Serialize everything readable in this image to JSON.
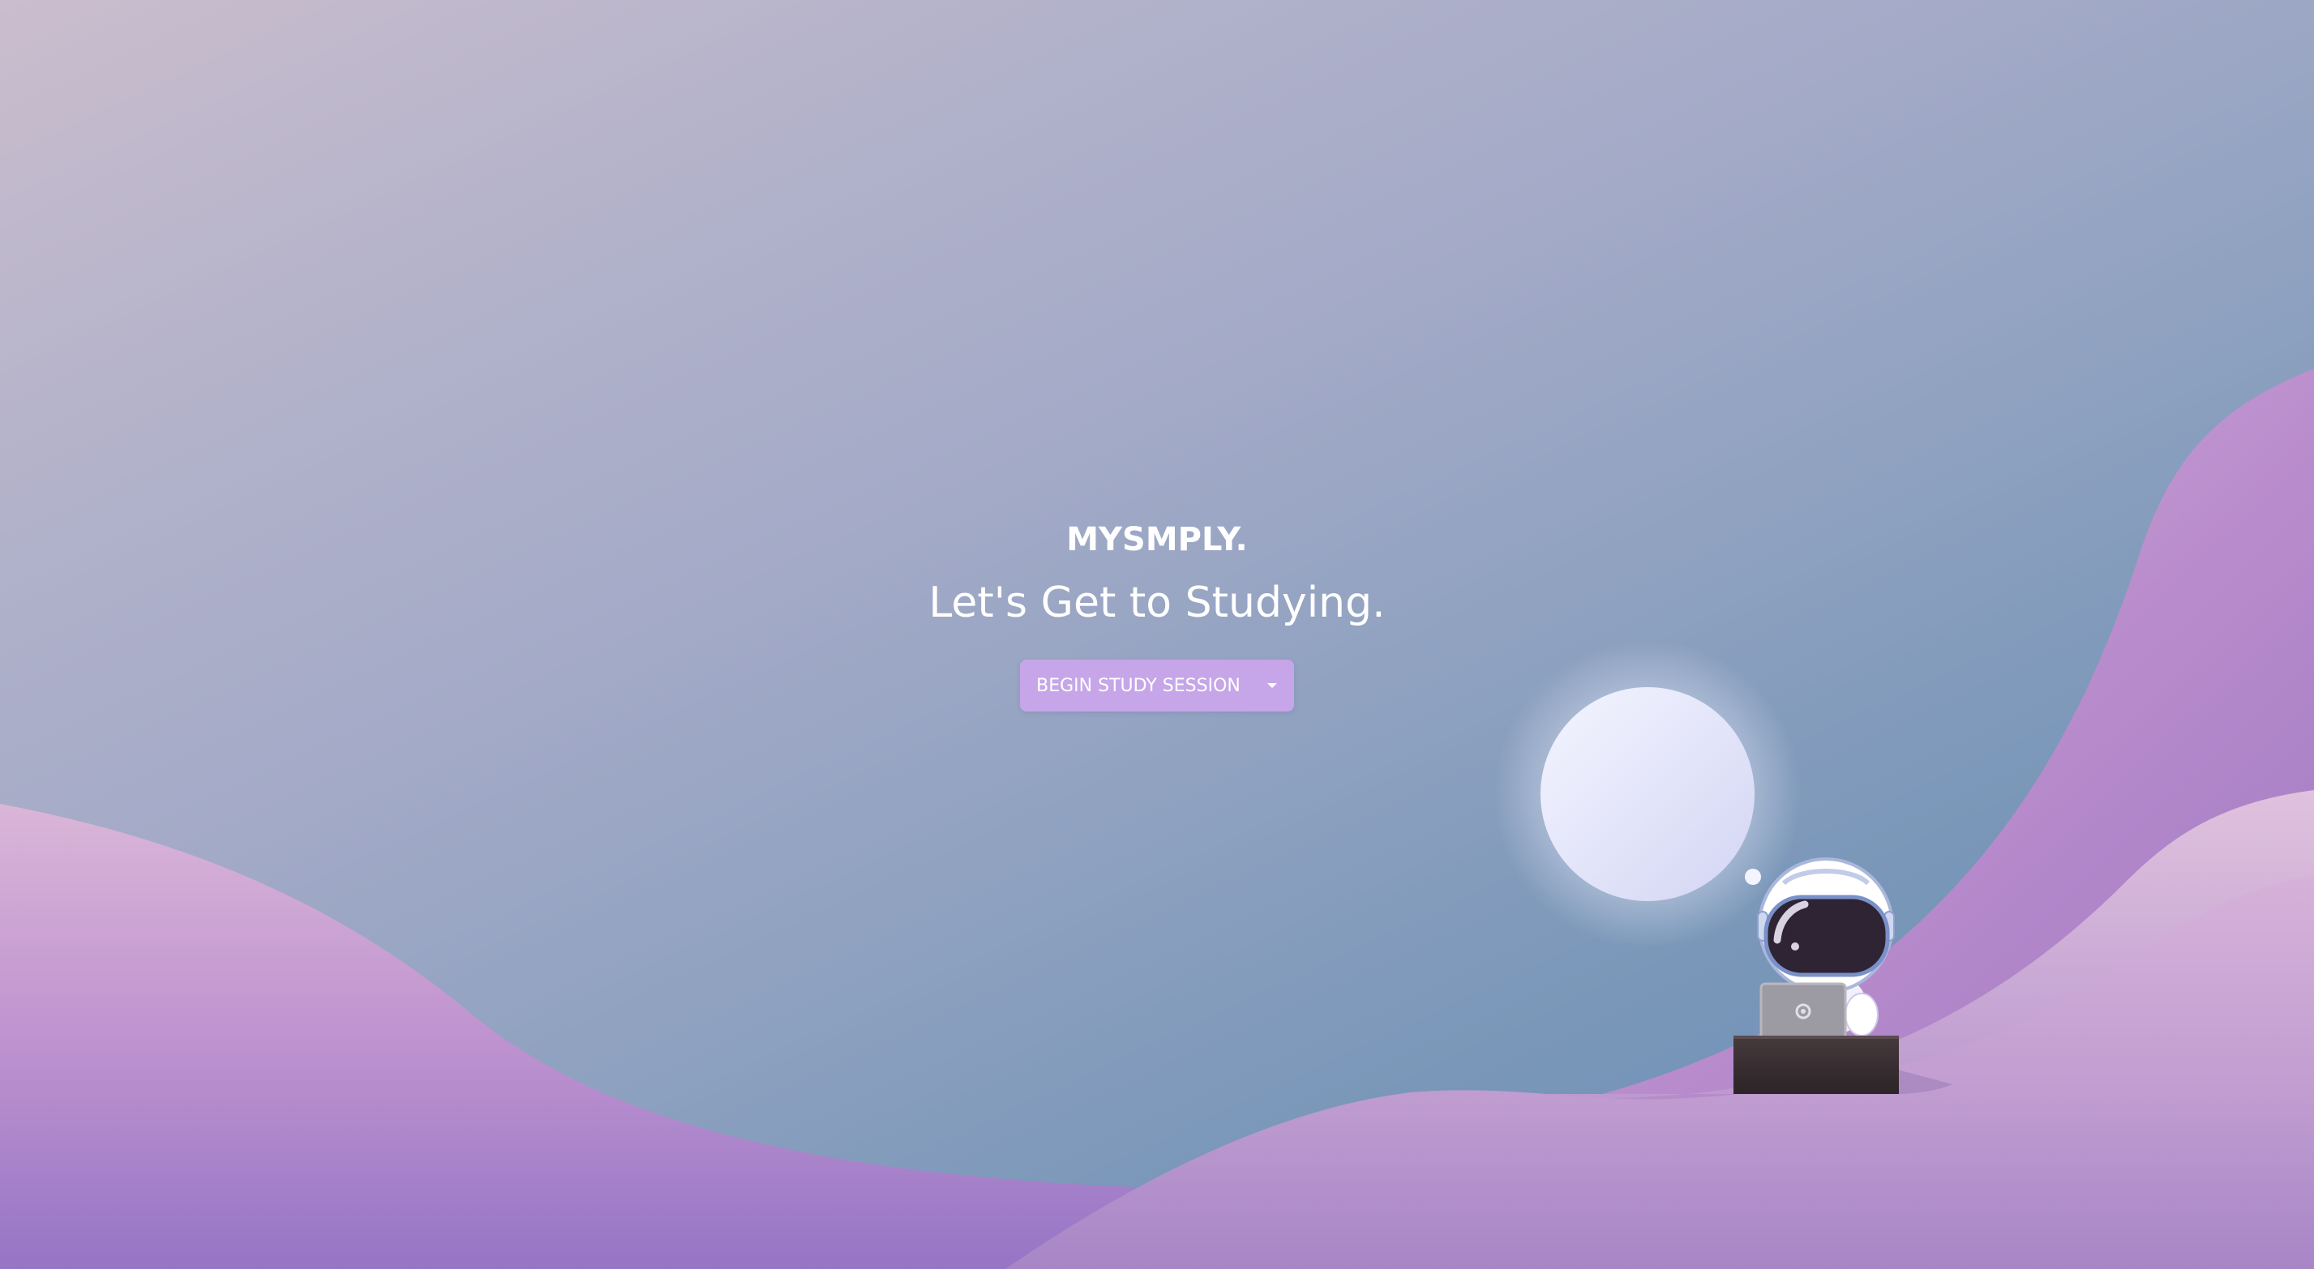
{
  "brand": "MYSMPLY.",
  "tagline": "Let's Get to Studying.",
  "cta": {
    "label": "BEGIN STUDY SESSION",
    "toggle_icon": "chevron-down-icon"
  },
  "illustration": {
    "subject": "astronaut-icon",
    "props": [
      "laptop-icon",
      "desk",
      "moon",
      "thought-bubble"
    ]
  },
  "colors": {
    "sky_top": "#cabdcd",
    "sky_bottom": "#6c8db4",
    "hills_light": "#dcb7db",
    "hills_dark": "#9a78c8",
    "button": "#c6a6e8",
    "moon": "#e8e8fb",
    "text": "#ffffff"
  }
}
